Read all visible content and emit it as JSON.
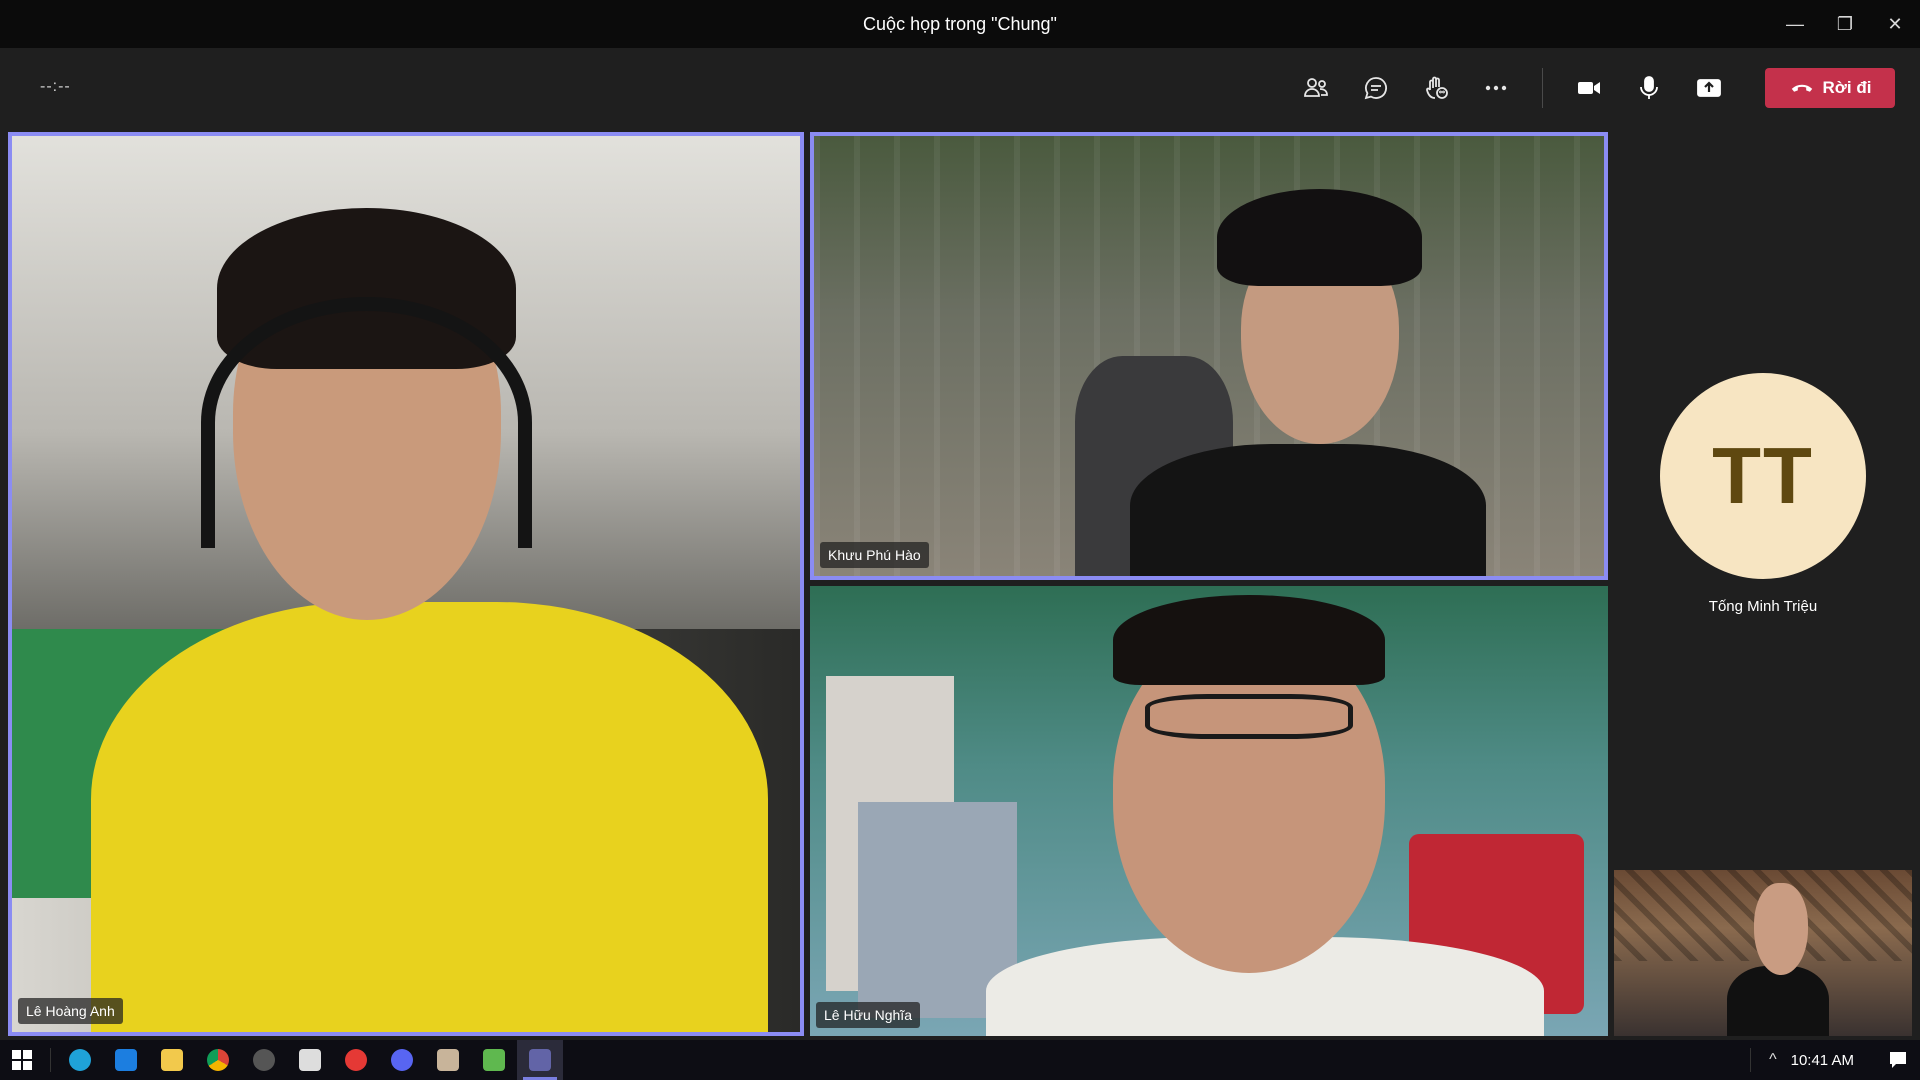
{
  "window": {
    "title": "Cuộc họp trong \"Chung\"",
    "minimize": "—",
    "restore": "❐",
    "close": "✕"
  },
  "toolbar": {
    "timer": "--:--",
    "leave_label": "Rời đi",
    "icons": [
      "participants-icon",
      "chat-icon",
      "reactions-icon",
      "more-icon",
      "camera-icon",
      "microphone-icon",
      "share-icon"
    ]
  },
  "participants": [
    {
      "name": "Lê Hoàng Anh",
      "speaking": true
    },
    {
      "name": "Khưu Phú Hào",
      "speaking": true
    },
    {
      "name": "Lê Hữu Nghĩa",
      "speaking": false
    },
    {
      "name": "Tống Minh Triệu",
      "initials": "TT",
      "avatar_color": "#f7e5c2"
    }
  ],
  "taskbar": {
    "clock": "10:41 AM",
    "apps": [
      "edge",
      "mail",
      "file-explorer",
      "chrome",
      "app-5",
      "app-6",
      "app-7",
      "discord",
      "app-9",
      "app-10",
      "teams"
    ],
    "chevron": "^"
  },
  "colors": {
    "accent": "#8b8cf3",
    "leave": "#c4314b"
  }
}
